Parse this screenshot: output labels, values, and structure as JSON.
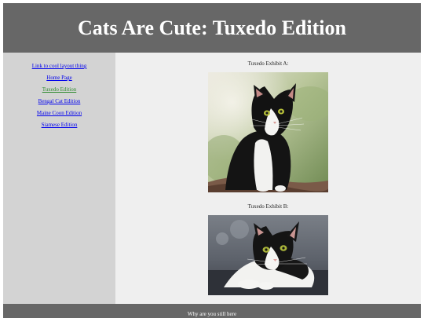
{
  "header": {
    "title": "Cats Are Cute: Tuxedo Edition"
  },
  "sidebar": {
    "items": [
      {
        "label": "Link to cool layout thing"
      },
      {
        "label": "Home Page"
      },
      {
        "label": "Tuxedo Edition"
      },
      {
        "label": "Bengal Cat Edition"
      },
      {
        "label": "Maine Coon Edition"
      },
      {
        "label": "Siamese Edition"
      }
    ],
    "active_label": "Tuxedo Edition"
  },
  "main": {
    "exhibits": [
      {
        "caption": "Tuxedo Exhibit A:"
      },
      {
        "caption": "Tuxedo Exhibit B:"
      }
    ]
  },
  "footer": {
    "text": "Why are you still here"
  },
  "colors": {
    "header_bg": "#676767",
    "sidebar_bg": "#d3d3d3",
    "main_bg": "#efefef",
    "link": "#0000ee",
    "active_link": "#2e8b2e"
  }
}
